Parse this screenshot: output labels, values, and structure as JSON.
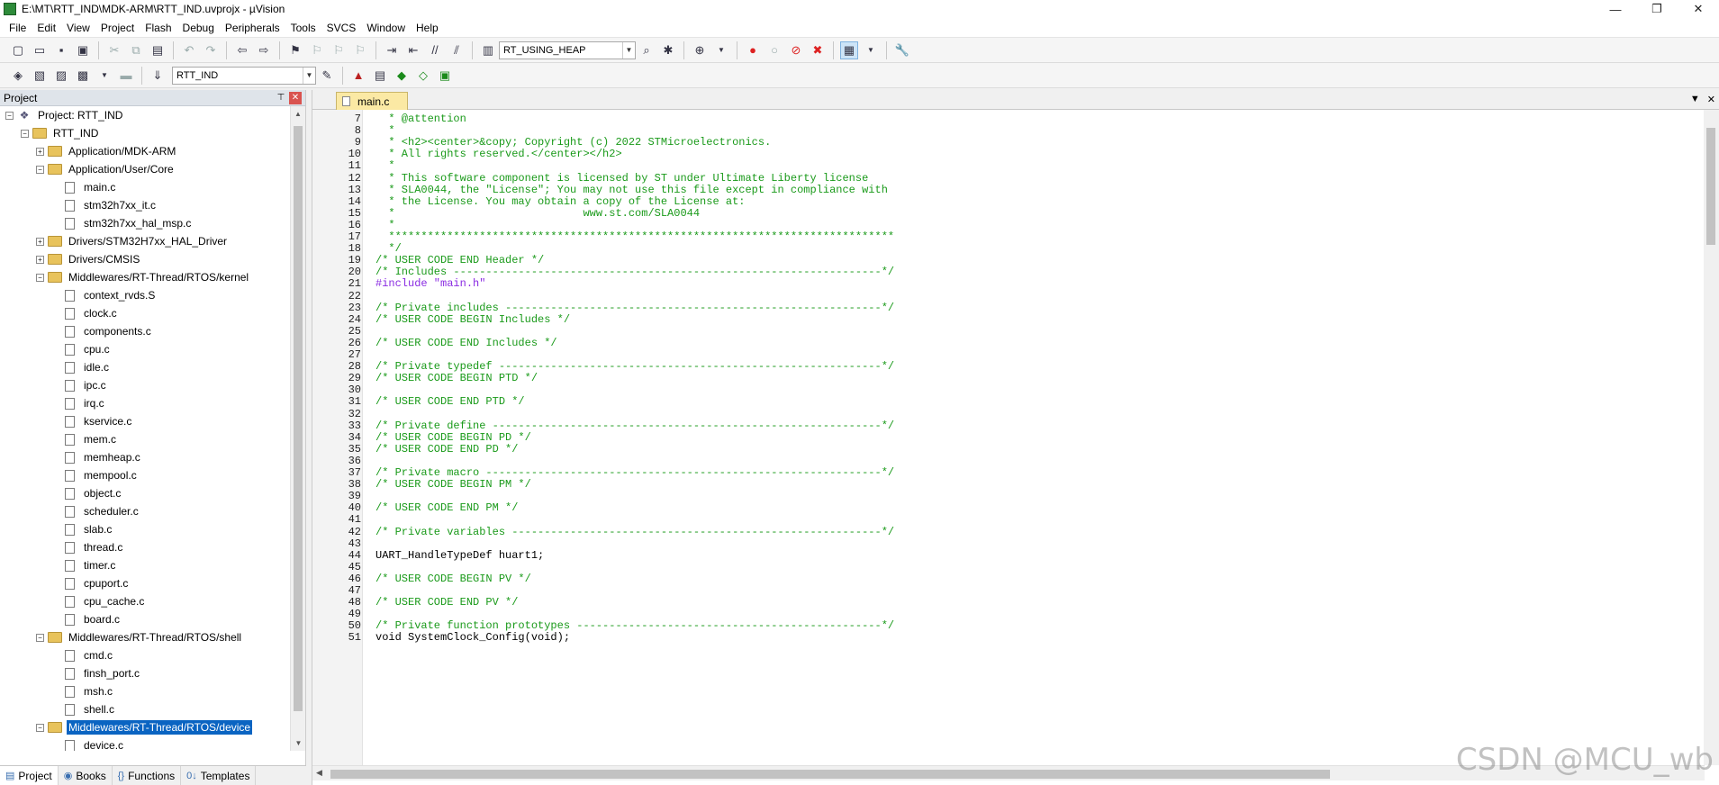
{
  "window": {
    "title": "E:\\MT\\RTT_IND\\MDK-ARM\\RTT_IND.uvprojx - µVision",
    "minimize": "—",
    "restore": "❐",
    "close": "✕"
  },
  "menu": [
    "File",
    "Edit",
    "View",
    "Project",
    "Flash",
    "Debug",
    "Peripherals",
    "Tools",
    "SVCS",
    "Window",
    "Help"
  ],
  "toolbar1": {
    "config_combo": "RT_USING_HEAP"
  },
  "toolbar2": {
    "target_combo": "RTT_IND"
  },
  "project_panel": {
    "title": "Project",
    "tree": [
      {
        "label": "Project: RTT_IND",
        "depth": 0,
        "kind": "project",
        "expander": "−"
      },
      {
        "label": "RTT_IND",
        "depth": 1,
        "kind": "target",
        "expander": "−"
      },
      {
        "label": "Application/MDK-ARM",
        "depth": 2,
        "kind": "folder",
        "expander": "+"
      },
      {
        "label": "Application/User/Core",
        "depth": 2,
        "kind": "folder",
        "expander": "−"
      },
      {
        "label": "main.c",
        "depth": 3,
        "kind": "file"
      },
      {
        "label": "stm32h7xx_it.c",
        "depth": 3,
        "kind": "file"
      },
      {
        "label": "stm32h7xx_hal_msp.c",
        "depth": 3,
        "kind": "file"
      },
      {
        "label": "Drivers/STM32H7xx_HAL_Driver",
        "depth": 2,
        "kind": "folder",
        "expander": "+"
      },
      {
        "label": "Drivers/CMSIS",
        "depth": 2,
        "kind": "folder",
        "expander": "+"
      },
      {
        "label": "Middlewares/RT-Thread/RTOS/kernel",
        "depth": 2,
        "kind": "folder",
        "expander": "−"
      },
      {
        "label": "context_rvds.S",
        "depth": 3,
        "kind": "file"
      },
      {
        "label": "clock.c",
        "depth": 3,
        "kind": "file"
      },
      {
        "label": "components.c",
        "depth": 3,
        "kind": "file"
      },
      {
        "label": "cpu.c",
        "depth": 3,
        "kind": "file"
      },
      {
        "label": "idle.c",
        "depth": 3,
        "kind": "file"
      },
      {
        "label": "ipc.c",
        "depth": 3,
        "kind": "file"
      },
      {
        "label": "irq.c",
        "depth": 3,
        "kind": "file"
      },
      {
        "label": "kservice.c",
        "depth": 3,
        "kind": "file"
      },
      {
        "label": "mem.c",
        "depth": 3,
        "kind": "file"
      },
      {
        "label": "memheap.c",
        "depth": 3,
        "kind": "file"
      },
      {
        "label": "mempool.c",
        "depth": 3,
        "kind": "file"
      },
      {
        "label": "object.c",
        "depth": 3,
        "kind": "file"
      },
      {
        "label": "scheduler.c",
        "depth": 3,
        "kind": "file"
      },
      {
        "label": "slab.c",
        "depth": 3,
        "kind": "file"
      },
      {
        "label": "thread.c",
        "depth": 3,
        "kind": "file"
      },
      {
        "label": "timer.c",
        "depth": 3,
        "kind": "file"
      },
      {
        "label": "cpuport.c",
        "depth": 3,
        "kind": "file"
      },
      {
        "label": "cpu_cache.c",
        "depth": 3,
        "kind": "file"
      },
      {
        "label": "board.c",
        "depth": 3,
        "kind": "file"
      },
      {
        "label": "Middlewares/RT-Thread/RTOS/shell",
        "depth": 2,
        "kind": "folder",
        "expander": "−"
      },
      {
        "label": "cmd.c",
        "depth": 3,
        "kind": "file"
      },
      {
        "label": "finsh_port.c",
        "depth": 3,
        "kind": "file"
      },
      {
        "label": "msh.c",
        "depth": 3,
        "kind": "file"
      },
      {
        "label": "shell.c",
        "depth": 3,
        "kind": "file"
      },
      {
        "label": "Middlewares/RT-Thread/RTOS/device",
        "depth": 2,
        "kind": "folder",
        "expander": "−",
        "selected": true
      },
      {
        "label": "device.c",
        "depth": 3,
        "kind": "file"
      }
    ],
    "bottom_tabs": [
      {
        "label": "Project",
        "icon": "▤"
      },
      {
        "label": "Books",
        "icon": "◉"
      },
      {
        "label": "Functions",
        "icon": "{}"
      },
      {
        "label": "Templates",
        "icon": "0↓"
      }
    ]
  },
  "editor": {
    "tab_label": "main.c",
    "lines": [
      {
        "n": "7",
        "t": "  * @attention",
        "s": "comment"
      },
      {
        "n": "8",
        "t": "  *",
        "s": "comment"
      },
      {
        "n": "9",
        "t": "  * <h2><center>&copy; Copyright (c) 2022 STMicroelectronics.",
        "s": "comment"
      },
      {
        "n": "10",
        "t": "  * All rights reserved.</center></h2>",
        "s": "comment"
      },
      {
        "n": "11",
        "t": "  *",
        "s": "comment"
      },
      {
        "n": "12",
        "t": "  * This software component is licensed by ST under Ultimate Liberty license",
        "s": "comment"
      },
      {
        "n": "13",
        "t": "  * SLA0044, the \"License\"; You may not use this file except in compliance with",
        "s": "comment"
      },
      {
        "n": "14",
        "t": "  * the License. You may obtain a copy of the License at:",
        "s": "comment"
      },
      {
        "n": "15",
        "t": "  *                             www.st.com/SLA0044",
        "s": "comment"
      },
      {
        "n": "16",
        "t": "  *",
        "s": "comment"
      },
      {
        "n": "17",
        "t": "  ******************************************************************************",
        "s": "comment"
      },
      {
        "n": "18",
        "t": "  */",
        "s": "comment"
      },
      {
        "n": "19",
        "t": "/* USER CODE END Header */",
        "s": "comment"
      },
      {
        "n": "20",
        "t": "/* Includes ------------------------------------------------------------------*/",
        "s": "comment"
      },
      {
        "n": "21",
        "t": "#include \"main.h\"",
        "s": "preproc"
      },
      {
        "n": "22",
        "t": "",
        "s": "plain"
      },
      {
        "n": "23",
        "t": "/* Private includes ----------------------------------------------------------*/",
        "s": "comment"
      },
      {
        "n": "24",
        "t": "/* USER CODE BEGIN Includes */",
        "s": "comment"
      },
      {
        "n": "25",
        "t": "",
        "s": "plain"
      },
      {
        "n": "26",
        "t": "/* USER CODE END Includes */",
        "s": "comment"
      },
      {
        "n": "27",
        "t": "",
        "s": "plain"
      },
      {
        "n": "28",
        "t": "/* Private typedef -----------------------------------------------------------*/",
        "s": "comment"
      },
      {
        "n": "29",
        "t": "/* USER CODE BEGIN PTD */",
        "s": "comment"
      },
      {
        "n": "30",
        "t": "",
        "s": "plain"
      },
      {
        "n": "31",
        "t": "/* USER CODE END PTD */",
        "s": "comment"
      },
      {
        "n": "32",
        "t": "",
        "s": "plain"
      },
      {
        "n": "33",
        "t": "/* Private define ------------------------------------------------------------*/",
        "s": "comment"
      },
      {
        "n": "34",
        "t": "/* USER CODE BEGIN PD */",
        "s": "comment"
      },
      {
        "n": "35",
        "t": "/* USER CODE END PD */",
        "s": "comment"
      },
      {
        "n": "36",
        "t": "",
        "s": "plain"
      },
      {
        "n": "37",
        "t": "/* Private macro -------------------------------------------------------------*/",
        "s": "comment"
      },
      {
        "n": "38",
        "t": "/* USER CODE BEGIN PM */",
        "s": "comment"
      },
      {
        "n": "39",
        "t": "",
        "s": "plain"
      },
      {
        "n": "40",
        "t": "/* USER CODE END PM */",
        "s": "comment"
      },
      {
        "n": "41",
        "t": "",
        "s": "plain"
      },
      {
        "n": "42",
        "t": "/* Private variables ---------------------------------------------------------*/",
        "s": "comment"
      },
      {
        "n": "43",
        "t": "",
        "s": "plain"
      },
      {
        "n": "44",
        "t": "UART_HandleTypeDef huart1;",
        "s": "plain"
      },
      {
        "n": "45",
        "t": "",
        "s": "plain"
      },
      {
        "n": "46",
        "t": "/* USER CODE BEGIN PV */",
        "s": "comment"
      },
      {
        "n": "47",
        "t": "",
        "s": "plain"
      },
      {
        "n": "48",
        "t": "/* USER CODE END PV */",
        "s": "comment"
      },
      {
        "n": "49",
        "t": "",
        "s": "plain"
      },
      {
        "n": "50",
        "t": "/* Private function prototypes -----------------------------------------------*/",
        "s": "comment"
      },
      {
        "n": "51",
        "t": "void SystemClock_Config(void);",
        "s": "plain"
      }
    ]
  },
  "watermark": "CSDN @MCU_wb"
}
